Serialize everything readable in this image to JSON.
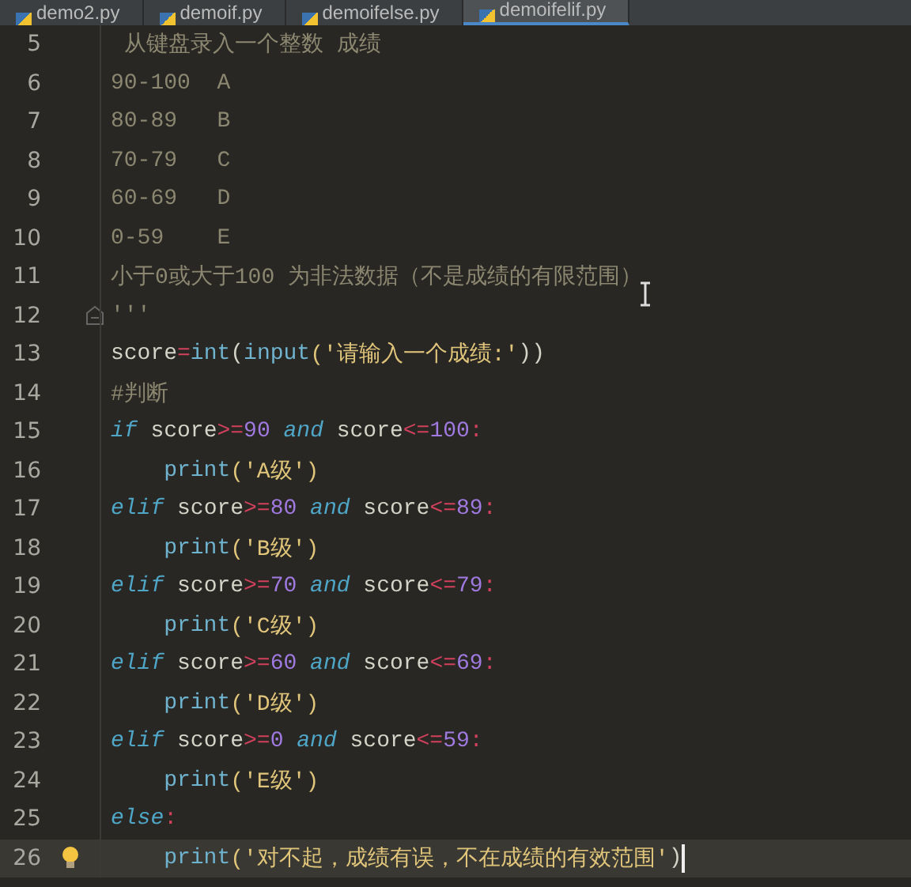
{
  "tabs": [
    {
      "label": "demo2.py",
      "selected": false
    },
    {
      "label": "demoif.py",
      "selected": false
    },
    {
      "label": "demoifelse.py",
      "selected": false
    },
    {
      "label": "demoifelif.py",
      "selected": true
    }
  ],
  "lines": [
    {
      "number": "5",
      "current": false,
      "tokens": [
        {
          "text": " 从键盘录入一个整数 成绩",
          "kind": "doc"
        }
      ]
    },
    {
      "number": "6",
      "current": false,
      "tokens": [
        {
          "text": "90-100  A",
          "kind": "doc"
        }
      ]
    },
    {
      "number": "7",
      "current": false,
      "tokens": [
        {
          "text": "80-89   B",
          "kind": "doc"
        }
      ]
    },
    {
      "number": "8",
      "current": false,
      "tokens": [
        {
          "text": "70-79   C",
          "kind": "doc"
        }
      ]
    },
    {
      "number": "9",
      "current": false,
      "tokens": [
        {
          "text": "60-69   D",
          "kind": "doc"
        }
      ]
    },
    {
      "number": "10",
      "current": false,
      "tokens": [
        {
          "text": "0-59    E",
          "kind": "doc"
        }
      ]
    },
    {
      "number": "11",
      "current": false,
      "tokens": [
        {
          "text": "小于0或大于100 为非法数据（不是成绩的有限范围）",
          "kind": "doc"
        }
      ]
    },
    {
      "number": "12",
      "current": false,
      "fold": true,
      "tokens": [
        {
          "text": "'''",
          "kind": "doc"
        }
      ]
    },
    {
      "number": "13",
      "current": false,
      "tokens": [
        {
          "text": "score",
          "kind": "plain"
        },
        {
          "text": "=",
          "kind": "op"
        },
        {
          "text": "int",
          "kind": "builtin"
        },
        {
          "text": "(",
          "kind": "plain"
        },
        {
          "text": "input",
          "kind": "builtin"
        },
        {
          "text": "('请输入一个成绩:'",
          "kind": "string"
        },
        {
          "text": "))",
          "kind": "plain"
        }
      ]
    },
    {
      "number": "14",
      "current": false,
      "tokens": [
        {
          "text": "#判断",
          "kind": "comment"
        }
      ]
    },
    {
      "number": "15",
      "current": false,
      "tokens": [
        {
          "text": "if",
          "kind": "keyword"
        },
        {
          "text": " score",
          "kind": "plain"
        },
        {
          "text": ">=",
          "kind": "op"
        },
        {
          "text": "90",
          "kind": "number"
        },
        {
          "text": " and",
          "kind": "keyword"
        },
        {
          "text": " score",
          "kind": "plain"
        },
        {
          "text": "<=",
          "kind": "op"
        },
        {
          "text": "100",
          "kind": "number"
        },
        {
          "text": ":",
          "kind": "op"
        }
      ]
    },
    {
      "number": "16",
      "current": false,
      "tokens": [
        {
          "text": "    print",
          "kind": "builtin"
        },
        {
          "text": "('A级')",
          "kind": "string"
        }
      ]
    },
    {
      "number": "17",
      "current": false,
      "tokens": [
        {
          "text": "elif",
          "kind": "keyword"
        },
        {
          "text": " score",
          "kind": "plain"
        },
        {
          "text": ">=",
          "kind": "op"
        },
        {
          "text": "80",
          "kind": "number"
        },
        {
          "text": " and",
          "kind": "keyword"
        },
        {
          "text": " score",
          "kind": "plain"
        },
        {
          "text": "<=",
          "kind": "op"
        },
        {
          "text": "89",
          "kind": "number"
        },
        {
          "text": ":",
          "kind": "op"
        }
      ]
    },
    {
      "number": "18",
      "current": false,
      "tokens": [
        {
          "text": "    print",
          "kind": "builtin"
        },
        {
          "text": "('B级')",
          "kind": "string"
        }
      ]
    },
    {
      "number": "19",
      "current": false,
      "tokens": [
        {
          "text": "elif",
          "kind": "keyword"
        },
        {
          "text": " score",
          "kind": "plain"
        },
        {
          "text": ">=",
          "kind": "op"
        },
        {
          "text": "70",
          "kind": "number"
        },
        {
          "text": " and",
          "kind": "keyword"
        },
        {
          "text": " score",
          "kind": "plain"
        },
        {
          "text": "<=",
          "kind": "op"
        },
        {
          "text": "79",
          "kind": "number"
        },
        {
          "text": ":",
          "kind": "op"
        }
      ]
    },
    {
      "number": "20",
      "current": false,
      "tokens": [
        {
          "text": "    print",
          "kind": "builtin"
        },
        {
          "text": "('C级')",
          "kind": "string"
        }
      ]
    },
    {
      "number": "21",
      "current": false,
      "tokens": [
        {
          "text": "elif",
          "kind": "keyword"
        },
        {
          "text": " score",
          "kind": "plain"
        },
        {
          "text": ">=",
          "kind": "op"
        },
        {
          "text": "60",
          "kind": "number"
        },
        {
          "text": " and",
          "kind": "keyword"
        },
        {
          "text": " score",
          "kind": "plain"
        },
        {
          "text": "<=",
          "kind": "op"
        },
        {
          "text": "69",
          "kind": "number"
        },
        {
          "text": ":",
          "kind": "op"
        }
      ]
    },
    {
      "number": "22",
      "current": false,
      "tokens": [
        {
          "text": "    print",
          "kind": "builtin"
        },
        {
          "text": "('D级')",
          "kind": "string"
        }
      ]
    },
    {
      "number": "23",
      "current": false,
      "tokens": [
        {
          "text": "elif",
          "kind": "keyword"
        },
        {
          "text": " score",
          "kind": "plain"
        },
        {
          "text": ">=",
          "kind": "op"
        },
        {
          "text": "0",
          "kind": "number"
        },
        {
          "text": " and",
          "kind": "keyword"
        },
        {
          "text": " score",
          "kind": "plain"
        },
        {
          "text": "<=",
          "kind": "op"
        },
        {
          "text": "59",
          "kind": "number"
        },
        {
          "text": ":",
          "kind": "op"
        }
      ]
    },
    {
      "number": "24",
      "current": false,
      "tokens": [
        {
          "text": "    print",
          "kind": "builtin"
        },
        {
          "text": "('E级')",
          "kind": "string"
        }
      ]
    },
    {
      "number": "25",
      "current": false,
      "tokens": [
        {
          "text": "else",
          "kind": "keyword"
        },
        {
          "text": ":",
          "kind": "op"
        }
      ]
    },
    {
      "number": "26",
      "current": true,
      "bulb": true,
      "tokens": [
        {
          "text": "    print",
          "kind": "builtin"
        },
        {
          "text": "('对不起，成绩有误，不在成绩的有效范围'",
          "kind": "string"
        },
        {
          "text": ")",
          "kind": "plain"
        }
      ]
    }
  ]
}
